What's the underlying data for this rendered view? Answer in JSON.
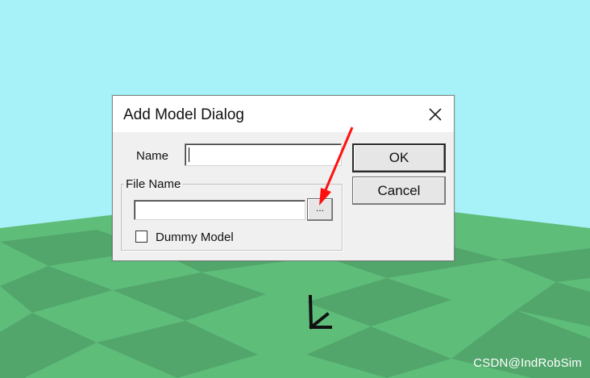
{
  "background": {
    "sky_color": "#a6f2f8",
    "floor_light": "#5fbd7a",
    "floor_dark": "#52a66b"
  },
  "dialog": {
    "title": "Add Model Dialog",
    "name_label": "Name",
    "name_value": "",
    "ok_label": "OK",
    "cancel_label": "Cancel",
    "file_group_label": "File Name",
    "file_value": "",
    "browse_label": "...",
    "dummy_model_label": "Dummy Model",
    "dummy_model_checked": false
  },
  "icons": {
    "close": "close-icon",
    "axis": "axis-gizmo-icon",
    "annotation": "red-arrow-annotation"
  },
  "annotation_color": "#ff1010",
  "watermark": "CSDN@IndRobSim"
}
